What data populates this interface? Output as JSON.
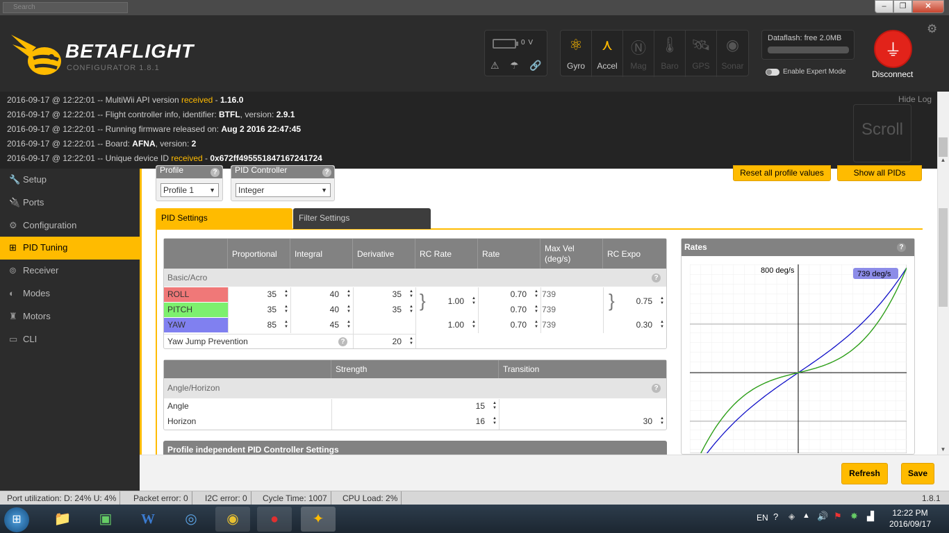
{
  "window": {
    "search_placeholder": "Search",
    "min": "–",
    "max": "❐",
    "close": "✕"
  },
  "header": {
    "brand": "BETAFLIGHT",
    "subtitle": "CONFIGURATOR  1.8.1",
    "battery_voltage": "0 V",
    "sensors": [
      {
        "label": "Gyro",
        "active": true
      },
      {
        "label": "Accel",
        "active": true
      },
      {
        "label": "Mag",
        "active": false
      },
      {
        "label": "Baro",
        "active": false
      },
      {
        "label": "GPS",
        "active": false
      },
      {
        "label": "Sonar",
        "active": false
      }
    ],
    "dataflash": "Dataflash: free 2.0MB",
    "expert_mode": "Enable Expert Mode",
    "disconnect": "Disconnect"
  },
  "log": {
    "hide": "Hide Log",
    "scroll": "Scroll",
    "lines": [
      {
        "pre": "2016-09-17 @ 12:22:01 -- MultiWii API version ",
        "hl": "received",
        "mid": " - ",
        "b": "1.16.0"
      },
      {
        "pre": "2016-09-17 @ 12:22:01 -- Flight controller info, identifier: ",
        "hl": "",
        "mid": "",
        "b": "BTFL",
        "post": ", version: ",
        "b2": "2.9.1"
      },
      {
        "pre": "2016-09-17 @ 12:22:01 -- Running firmware released on: ",
        "hl": "",
        "mid": "",
        "b": "Aug 2 2016 22:47:45"
      },
      {
        "pre": "2016-09-17 @ 12:22:01 -- Board: ",
        "hl": "",
        "mid": "",
        "b": "AFNA",
        "post": ", version: ",
        "b2": "2"
      },
      {
        "pre": "2016-09-17 @ 12:22:01 -- Unique device ID ",
        "hl": "received",
        "mid": " - ",
        "b": "0x672ff495551847167241724"
      }
    ]
  },
  "nav": [
    {
      "label": "Setup",
      "icon": "wrench-icon"
    },
    {
      "label": "Ports",
      "icon": "plug-icon"
    },
    {
      "label": "Configuration",
      "icon": "gear-icon"
    },
    {
      "label": "PID Tuning",
      "icon": "sitemap-icon",
      "active": true
    },
    {
      "label": "Receiver",
      "icon": "gamepad-icon"
    },
    {
      "label": "Modes",
      "icon": "toggle-icon"
    },
    {
      "label": "Motors",
      "icon": "motor-icon"
    },
    {
      "label": "CLI",
      "icon": "terminal-icon"
    }
  ],
  "pid": {
    "profile_label": "Profile",
    "profile_value": "Profile 1",
    "controller_label": "PID Controller",
    "controller_value": "Integer",
    "reset_btn": "Reset all profile values",
    "show_btn": "Show all PIDs",
    "tabs": [
      "PID Settings",
      "Filter Settings"
    ],
    "headers": [
      "Proportional",
      "Integral",
      "Derivative",
      "RC Rate",
      "Rate",
      "Max Vel (deg/s)",
      "RC Expo"
    ],
    "group_basic": "Basic/Acro",
    "rows": [
      {
        "name": "ROLL",
        "color": "#f07878",
        "p": "35",
        "i": "40",
        "d": "35",
        "rate": "0.70",
        "maxvel": "739"
      },
      {
        "name": "PITCH",
        "color": "#7df06e",
        "p": "35",
        "i": "40",
        "d": "35",
        "rate": "0.70",
        "maxvel": "739"
      },
      {
        "name": "YAW",
        "color": "#8080f0",
        "p": "85",
        "i": "45",
        "d": "",
        "rate": "0.70",
        "maxvel": "739"
      }
    ],
    "rc_rate_rp": "1.00",
    "rc_rate_yaw": "1.00",
    "rc_expo_rp": "0.75",
    "rc_expo_yaw": "0.30",
    "yaw_jump_label": "Yaw Jump Prevention",
    "yaw_jump_value": "20",
    "angle_headers": [
      "Strength",
      "Transition"
    ],
    "group_angle": "Angle/Horizon",
    "angle_label": "Angle",
    "angle_strength": "15",
    "horizon_label": "Horizon",
    "horizon_strength": "16",
    "horizon_transition": "30",
    "profile_indep": "Profile independent PID Controller Settings"
  },
  "rates": {
    "title": "Rates",
    "max_label": "800 deg/s",
    "current_label": "739 deg/s",
    "colors": {
      "roll": "#e02020",
      "pitch": "#20b020",
      "yaw": "#1010c8"
    }
  },
  "actions": {
    "refresh": "Refresh",
    "save": "Save"
  },
  "status": {
    "port": "Port utilization: D: 24% U: 4%",
    "packet": "Packet error: 0",
    "i2c": "I2C error: 0",
    "cycle": "Cycle Time: 1007",
    "cpu": "CPU Load: 2%",
    "version": "1.8.1"
  },
  "taskbar": {
    "lang": "EN",
    "time": "12:22 PM",
    "date": "2016/09/17"
  }
}
